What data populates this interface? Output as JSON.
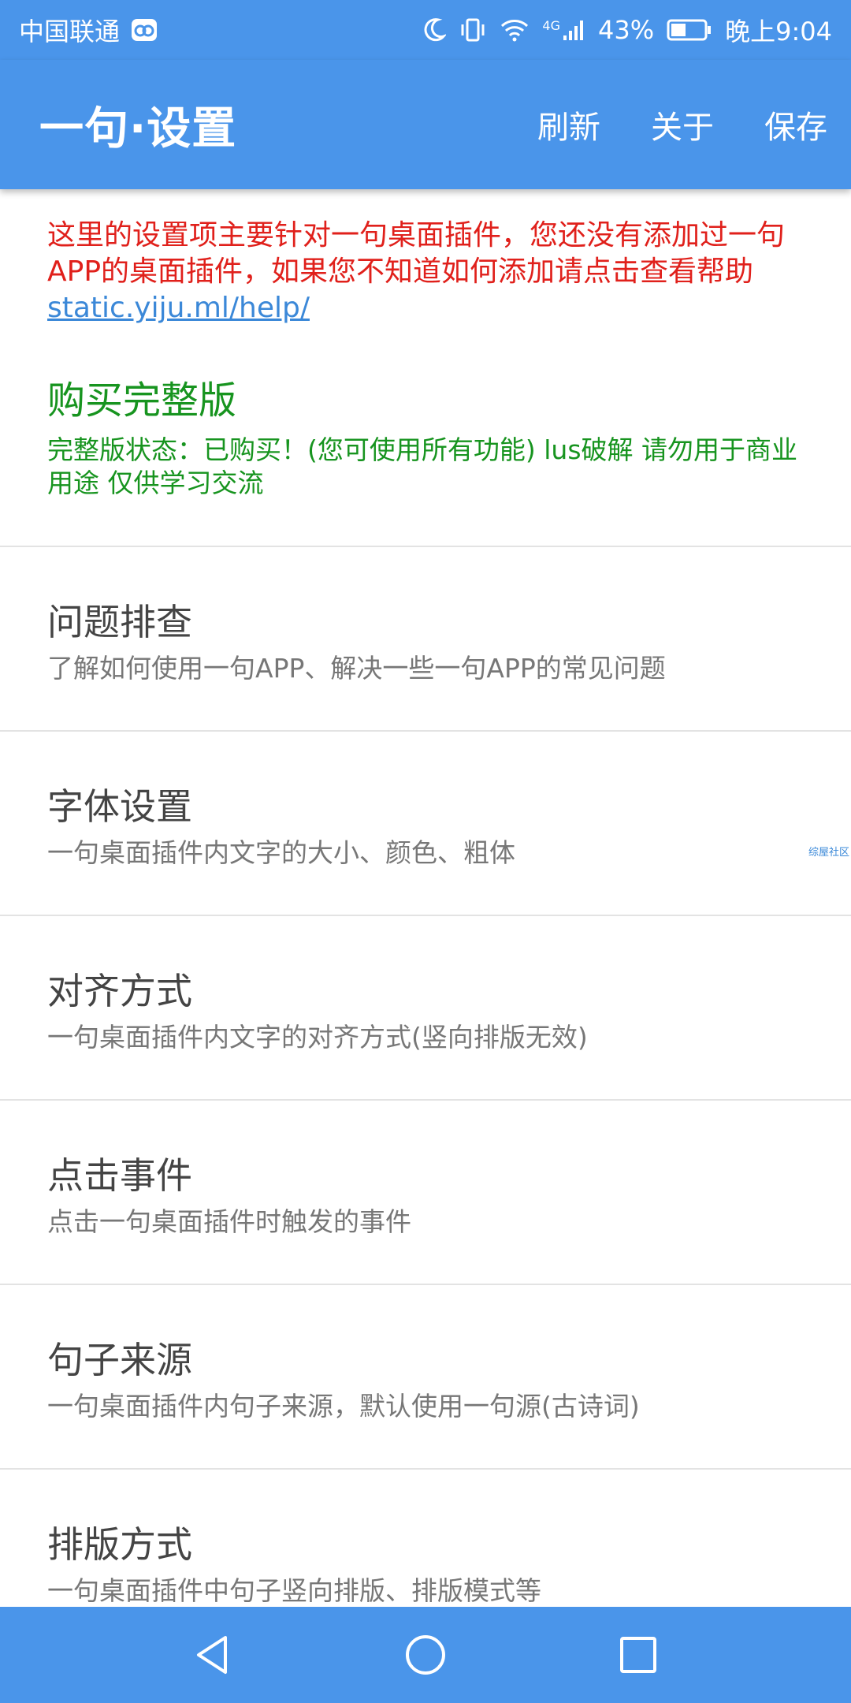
{
  "status_bar": {
    "carrier": "中国联通",
    "network": "4G",
    "battery": "43%",
    "time": "晚上9:04",
    "icons": [
      "cloud-app-icon",
      "moon-icon",
      "vibrate-icon",
      "wifi-icon",
      "signal-icon",
      "battery-icon"
    ]
  },
  "app_bar": {
    "title": "一句·设置",
    "actions": {
      "refresh": "刷新",
      "about": "关于",
      "save": "保存"
    }
  },
  "notice": {
    "text": "这里的设置项主要针对一句桌面插件，您还没有添加过一句APP的桌面插件，如果您不知道如何添加请点击查看帮助 ",
    "link": "static.yiju.ml/help/",
    "color": "#e0201b"
  },
  "purchase": {
    "title": "购买完整版",
    "desc": "完整版状态：已购买！(您可使用所有功能) lus破解 请勿用于商业用途 仅供学习交流",
    "color": "#17941f"
  },
  "items": [
    {
      "title": "问题排查",
      "desc": "了解如何使用一句APP、解决一些一句APP的常见问题"
    },
    {
      "title": "字体设置",
      "desc": "一句桌面插件内文字的大小、颜色、粗体"
    },
    {
      "title": "对齐方式",
      "desc": "一句桌面插件内文字的对齐方式(竖向排版无效)"
    },
    {
      "title": "点击事件",
      "desc": "点击一句桌面插件时触发的事件"
    },
    {
      "title": "句子来源",
      "desc": "一句桌面插件内句子来源，默认使用一句源(古诗词)"
    },
    {
      "title": "排版方式",
      "desc": "一句桌面插件中句子竖向排版、排版模式等"
    }
  ],
  "watermark": "综屋社区",
  "nav": {
    "icons": [
      "back-icon",
      "home-icon",
      "recents-icon"
    ]
  },
  "colors": {
    "primary": "#4a95ea",
    "link": "#3b88d8"
  }
}
